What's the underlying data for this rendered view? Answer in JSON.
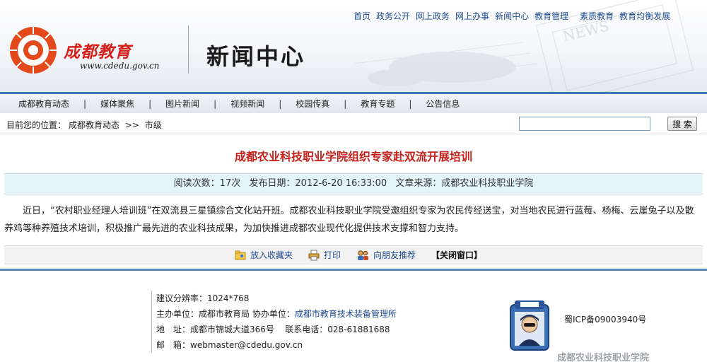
{
  "header": {
    "logo_name": "成都教育",
    "logo_url": "www.cdedu.gov.cn",
    "section_title": "新闻中心",
    "decor_text": "NEWS",
    "top_links": [
      "首页",
      "政务公开",
      "网上政务",
      "网上办事",
      "新闻中心",
      "教育管理",
      "素质教育",
      "教育均衡发展"
    ]
  },
  "nav": {
    "items": [
      "成都教育动态",
      "媒体聚焦",
      "图片新闻",
      "视频新闻",
      "校园传真",
      "教育专题",
      "公告信息"
    ],
    "separator": "|"
  },
  "breadcrumb": {
    "label": "目前您的位置：",
    "items": [
      "成都教育动态",
      ">>",
      "市级"
    ]
  },
  "search": {
    "value": "",
    "button_label": "搜 索"
  },
  "article": {
    "title": "成都农业科技职业学院组织专家赴双流开展培训",
    "meta": {
      "read_label": "阅读次数：",
      "read_count": "17次",
      "date_label": "发布日期：",
      "date": "2012-6-20 16:33:00",
      "source_label": "文章来源：",
      "source": "成都农业科技职业学院"
    },
    "body": "近日，“农村职业经理人培训班”在双流县三星镇综合文化站开班。成都农业科技职业学院受邀组织专家为农民传经送宝，对当地农民进行蓝莓、杨梅、云崖兔子以及散养鸡等种养殖技术培训，积极推广最先进的农业科技成果，为加快推进成都农业现代化提供技术支撑和智力支持。"
  },
  "actions": {
    "favorite": "放入收藏夹",
    "print": "打印",
    "recommend": "向朋友推荐",
    "close": "【关闭窗口】"
  },
  "footer": {
    "resolution": "建议分辨率：1024*768",
    "host_label": "主办单位：",
    "host": "成都市教育局",
    "co_label": "协办单位：",
    "co": "成都市教育技术装备管理所",
    "address_label": "地　址：",
    "address": "成都市锦城大道366号",
    "phone_label": "联系电话：",
    "phone": "028-61881688",
    "email_label": "邮　箱：",
    "email": "webmaster@cdedu.gov.cn",
    "icp": "蜀ICP备09003940号",
    "brand": "成都农业科技职业学院"
  },
  "colors": {
    "brand_red": "#d8201a",
    "title_red": "#c4211b",
    "link_blue": "#1e4b8f",
    "nav_border": "#3c78b8",
    "meta_bg": "#e3f5f9"
  }
}
